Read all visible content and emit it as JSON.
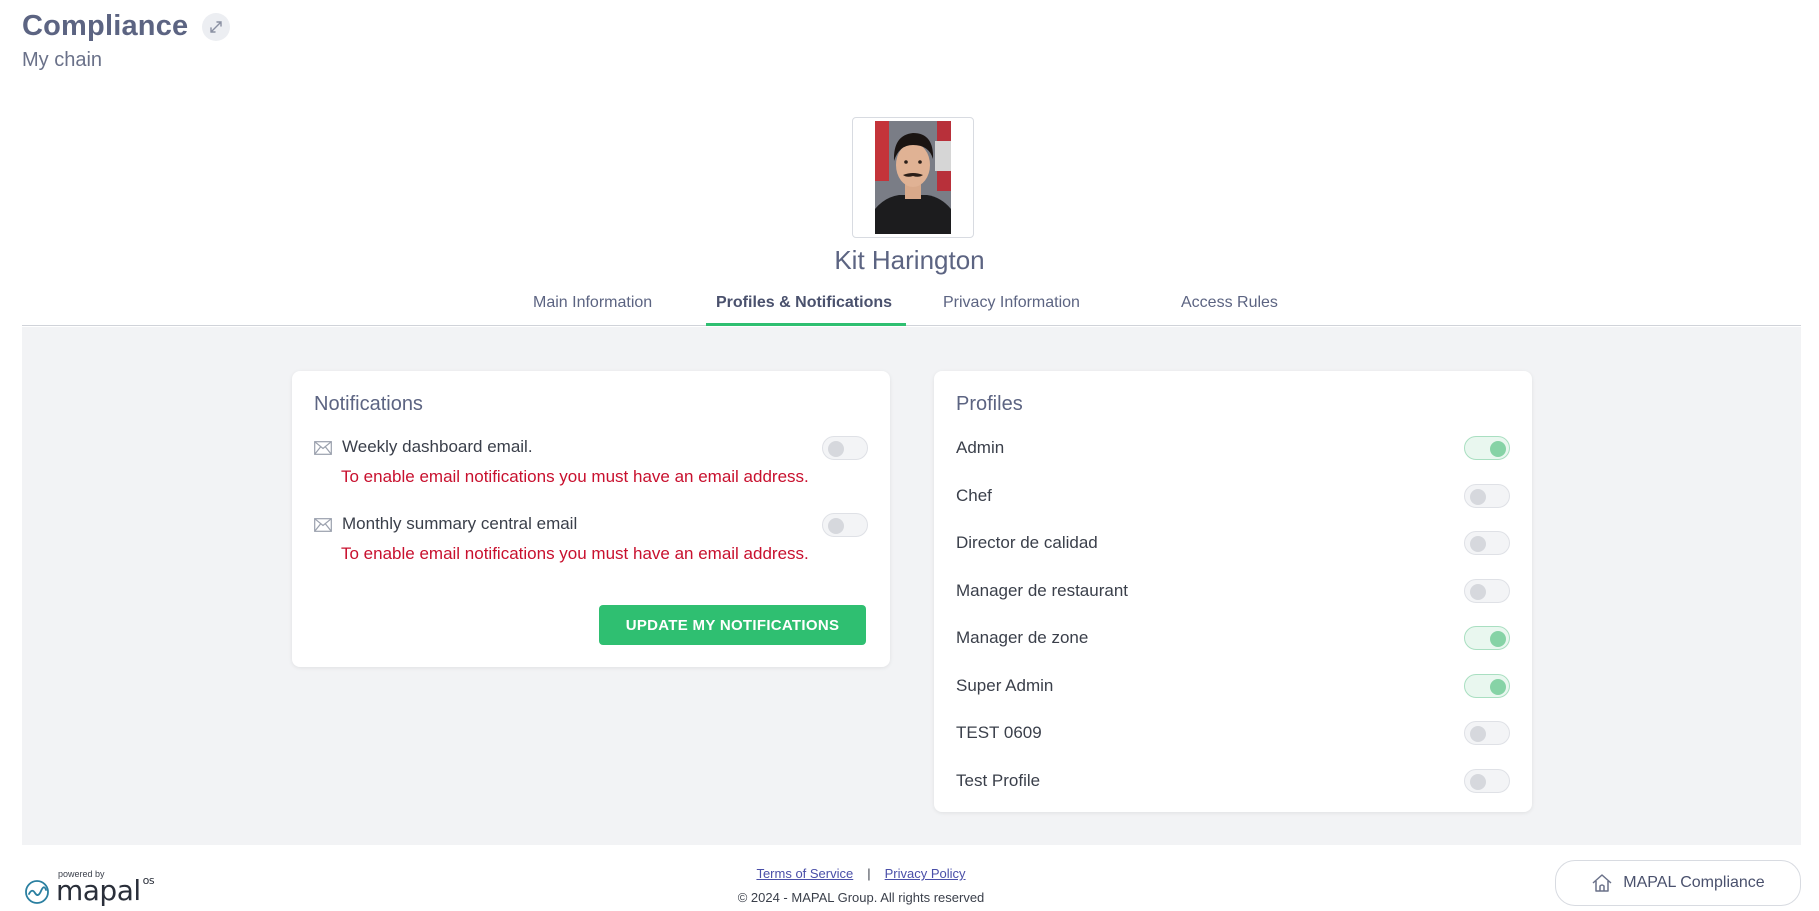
{
  "header": {
    "title": "Compliance",
    "subtitle": "My chain"
  },
  "user": {
    "name": "Kit Harington"
  },
  "tabs": [
    {
      "label": "Main Information",
      "active": false
    },
    {
      "label": "Profiles & Notifications",
      "active": true
    },
    {
      "label": "Privacy Information",
      "active": false
    },
    {
      "label": "Access Rules",
      "active": false
    }
  ],
  "notifications": {
    "title": "Notifications",
    "items": [
      {
        "label": "Weekly dashboard email.",
        "enabled": false,
        "error": "To enable email notifications you must have an email address."
      },
      {
        "label": "Monthly summary central email",
        "enabled": false,
        "error": "To enable email notifications you must have an email address."
      }
    ],
    "update_label": "UPDATE MY NOTIFICATIONS"
  },
  "profiles": {
    "title": "Profiles",
    "items": [
      {
        "label": "Admin",
        "enabled": true
      },
      {
        "label": "Chef",
        "enabled": false
      },
      {
        "label": "Director de calidad",
        "enabled": false
      },
      {
        "label": "Manager de restaurant",
        "enabled": false
      },
      {
        "label": "Manager de zone",
        "enabled": true
      },
      {
        "label": "Super Admin",
        "enabled": true
      },
      {
        "label": "TEST 0609",
        "enabled": false
      },
      {
        "label": "Test Profile",
        "enabled": false
      }
    ]
  },
  "footer": {
    "powered_by": "powered by",
    "logo_text": "mapal",
    "logo_suffix": "os",
    "terms": "Terms of Service",
    "separator": "|",
    "privacy": "Privacy Policy",
    "copyright": "© 2024 - MAPAL Group. All rights reserved",
    "app_button": "MAPAL Compliance"
  },
  "colors": {
    "accent": "#2fbf71",
    "error": "#c8102e",
    "title": "#5c6482"
  }
}
